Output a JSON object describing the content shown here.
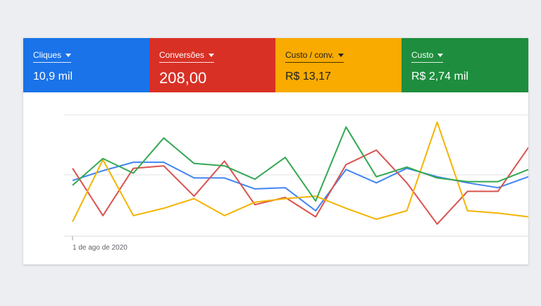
{
  "tiles": [
    {
      "label": "Cliques",
      "value": "10,9 mil",
      "color": "#1a73e8",
      "text_color": "#ffffff",
      "big": false
    },
    {
      "label": "Conversões",
      "value": "208,00",
      "color": "#d93025",
      "text_color": "#ffffff",
      "big": true
    },
    {
      "label": "Custo / conv.",
      "value": "R$ 13,17",
      "color": "#f9ab00",
      "text_color": "#202124",
      "big": false
    },
    {
      "label": "Custo",
      "value": "R$ 2,74 mil",
      "color": "#1e8e3e",
      "text_color": "#ffffff",
      "big": false
    }
  ],
  "chart": {
    "start_date_label": "1 de ago de 2020"
  },
  "chart_data": {
    "type": "line",
    "xlabel": "",
    "ylabel": "",
    "ylim": [
      0,
      100
    ],
    "grid": true,
    "series": [
      {
        "color": "#4285f4",
        "values": [
          46,
          54,
          61,
          61,
          48,
          48,
          39,
          40,
          21,
          55,
          44,
          56,
          49,
          44,
          40,
          49
        ]
      },
      {
        "color": "#d9534f",
        "values": [
          56,
          17,
          56,
          58,
          33,
          62,
          26,
          32,
          16,
          59,
          71,
          44,
          10,
          37,
          37,
          73
        ]
      },
      {
        "color": "#f4b400",
        "values": [
          12,
          63,
          17,
          23,
          31,
          17,
          28,
          31,
          33,
          23,
          14,
          21,
          94,
          21,
          19,
          16
        ]
      },
      {
        "color": "#34a853",
        "values": [
          42,
          64,
          52,
          81,
          60,
          58,
          47,
          65,
          29,
          90,
          49,
          57,
          48,
          45,
          45,
          55
        ]
      }
    ]
  }
}
